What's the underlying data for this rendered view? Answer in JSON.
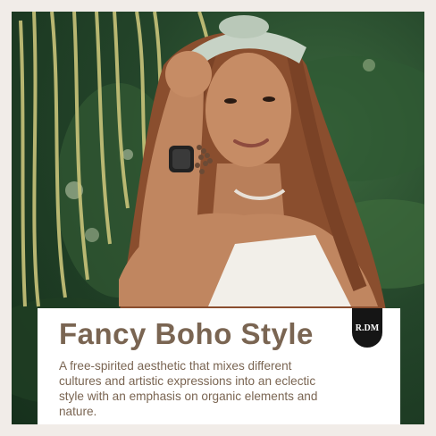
{
  "headline": "Fancy Boho Style",
  "description": "A free-spirited aesthetic that mixes different cultures and artistic expressions into an eclectic style with an emphasis on organic elements and nature.",
  "brand_badge": "R.DM",
  "colors": {
    "page_background": "#f1ece8",
    "card_background": "#ffffff",
    "headline_text": "#7a6552",
    "badge_background": "#151515",
    "foliage_dark": "#16301c",
    "foliage_mid": "#3c6a3e",
    "palm_fronds": "#c9c47a",
    "skin": "#c08660",
    "hair": "#8a4e2e"
  }
}
